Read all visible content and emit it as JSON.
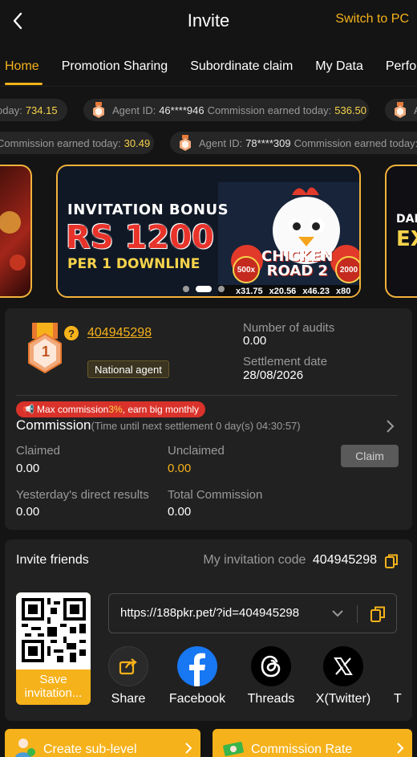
{
  "header": {
    "title": "Invite",
    "switch_label": "Switch to PC"
  },
  "tabs": [
    {
      "label": "Home"
    },
    {
      "label": "Promotion Sharing"
    },
    {
      "label": "Subordinate claim"
    },
    {
      "label": "My Data"
    },
    {
      "label": "Perform"
    }
  ],
  "ticker_row1": [
    {
      "prefix": "oday:",
      "amount": "734.15"
    },
    {
      "agent_label": "Agent ID:",
      "agent_id": "46****946",
      "earned_label": "Commission earned today:",
      "amount": "536.50"
    },
    {
      "agent_label": "A"
    }
  ],
  "ticker_row2": [
    {
      "prefix": "Commission earned today:",
      "amount": "30.49"
    },
    {
      "agent_label": "Agent ID:",
      "agent_id": "78****309",
      "earned_label": "Commission earned today:"
    }
  ],
  "banner": {
    "line1": "INVITATION BONUS",
    "line2": "RS 1200",
    "line3": "PER 1 DOWNLINE",
    "game_line1": "CHICKEN",
    "game_line2": "ROAD 2",
    "multipliers": [
      "x31.75",
      "x20.56",
      "x46.23",
      "x80"
    ],
    "chip_left": "500x",
    "chip_right": "2000",
    "right_peek_1": "DAI",
    "right_peek_2": "EX"
  },
  "agent": {
    "level": "1",
    "help": "?",
    "id": "404945298",
    "rank": "National agent",
    "audits_label": "Number of audits",
    "audits_value": "0.00",
    "settlement_label": "Settlement date",
    "settlement_value": "28/08/2026",
    "promo_prefix": "Max commission ",
    "promo_highlight": "3%",
    "promo_suffix": ", earn big monthly",
    "commission_title": "Commission",
    "countdown": "(Time until next settlement  0 day(s) 04:30:57)",
    "claimed_label": "Claimed",
    "claimed_value": "0.00",
    "unclaimed_label": "Unclaimed",
    "unclaimed_value": "0.00",
    "claim_button": "Claim",
    "yesterday_label": "Yesterday's direct results",
    "yesterday_value": "0.00",
    "total_label": "Total Commission",
    "total_value": "0.00"
  },
  "invite": {
    "title": "Invite friends",
    "code_label": "My invitation code",
    "code_value": "404945298",
    "link": "https://188pkr.pet/?id=404945298",
    "save_label": "Save invitation..."
  },
  "share": [
    {
      "label": "Share"
    },
    {
      "label": "Facebook"
    },
    {
      "label": "Threads"
    },
    {
      "label": "X(Twitter)"
    },
    {
      "label": "T"
    }
  ],
  "bottom": {
    "left_label": "Create sub-level",
    "right_label": "Commission Rate"
  },
  "colors": {
    "accent": "#f6b21b",
    "card": "#212121",
    "background": "#141414"
  }
}
